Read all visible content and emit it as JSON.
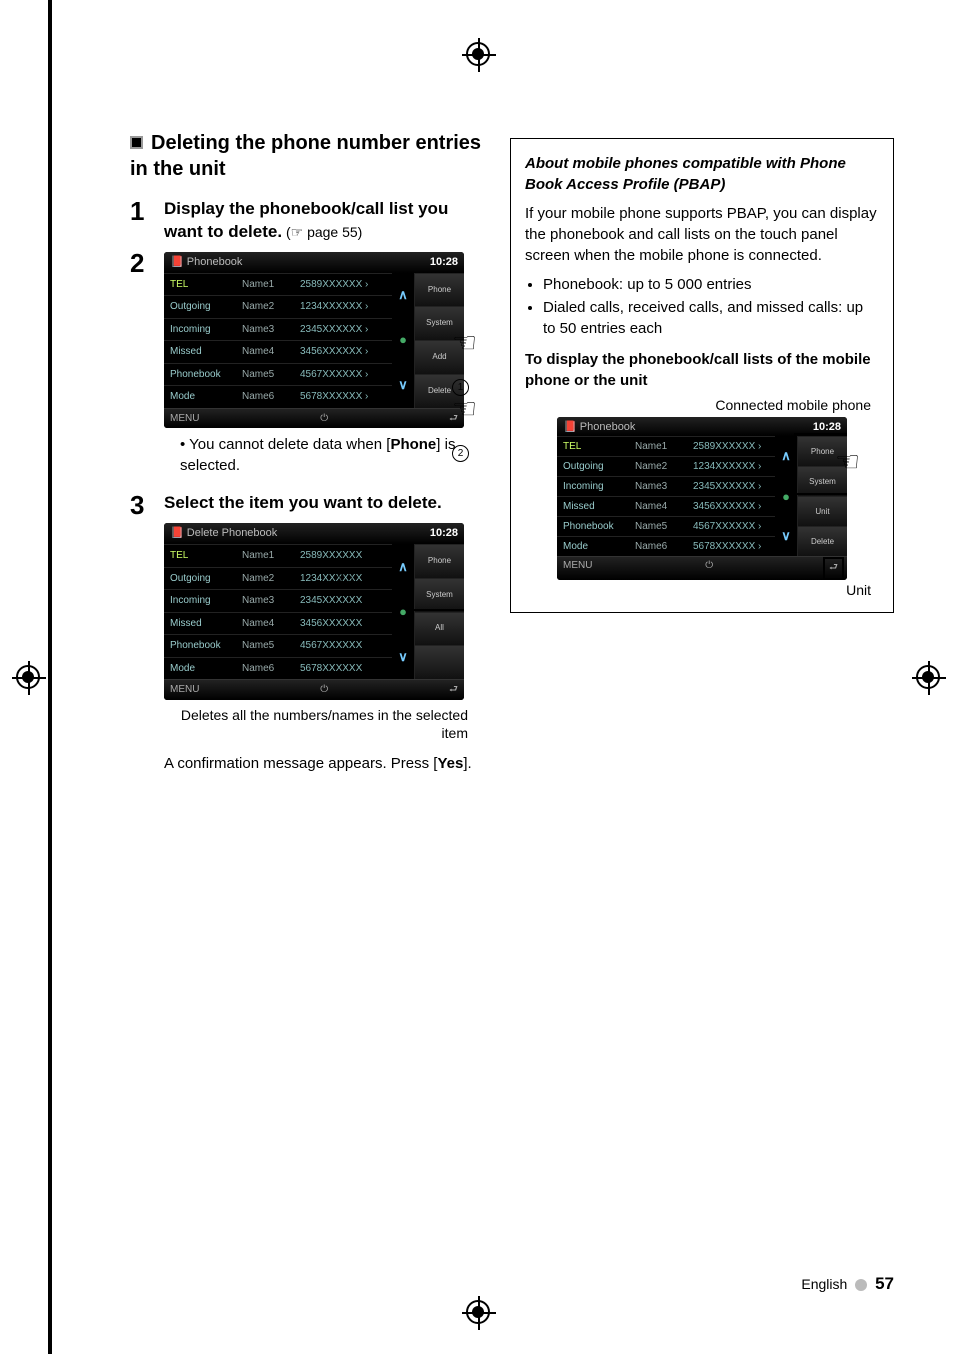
{
  "left": {
    "heading": "Deleting the phone number entries in the unit",
    "step1_bold": "Display the phonebook/call list you want to delete.",
    "step1_ref": " (☞ page 55)",
    "note1_pre": "• You cannot delete data when [",
    "note1_bold": "Phone",
    "note1_post": "] is selected.",
    "step3": "Select the item you want to delete.",
    "caption3": "Deletes all the numbers/names in the selected item",
    "confirm_pre": "A confirmation message appears. Press [",
    "confirm_bold": "Yes",
    "confirm_post": "]."
  },
  "right": {
    "title": "About mobile phones compatible with Phone Book Access Profile (PBAP)",
    "body": "If your mobile phone supports PBAP, you can display the phonebook and call lists on the touch panel screen when the mobile phone is connected.",
    "li1": "Phonebook: up to 5 000 entries",
    "li2": "Dialed calls, received calls, and missed calls: up to 50 entries each",
    "subhead": "To display the phonebook/call lists of the mobile phone or the unit",
    "label_top": "Connected mobile phone",
    "label_bottom": "Unit"
  },
  "device": {
    "title_pb": "Phonebook",
    "title_del": "Delete Phonebook",
    "clock": "10:28",
    "menu": "MENU",
    "back": "⮐",
    "side_btns_pb": [
      "Phone",
      "System",
      "Add",
      "Delete"
    ],
    "side_btns_del": [
      "Phone",
      "System",
      "All"
    ],
    "side_btns_box": [
      "Phone",
      "System",
      "Unit",
      "Delete"
    ],
    "cat": [
      "TEL",
      "Outgoing",
      "Incoming",
      "Missed",
      "Phonebook",
      "Mode"
    ],
    "rows": [
      {
        "n": "Name1",
        "p": "2589XXXXXX"
      },
      {
        "n": "Name2",
        "p": "1234XXXXXX"
      },
      {
        "n": "Name3",
        "p": "2345XXXXXX"
      },
      {
        "n": "Name4",
        "p": "3456XXXXXX"
      },
      {
        "n": "Name5",
        "p": "4567XXXXXX"
      },
      {
        "n": "Name6",
        "p": "5678XXXXXX"
      }
    ]
  },
  "footer": {
    "lang": "English",
    "page": "57"
  }
}
